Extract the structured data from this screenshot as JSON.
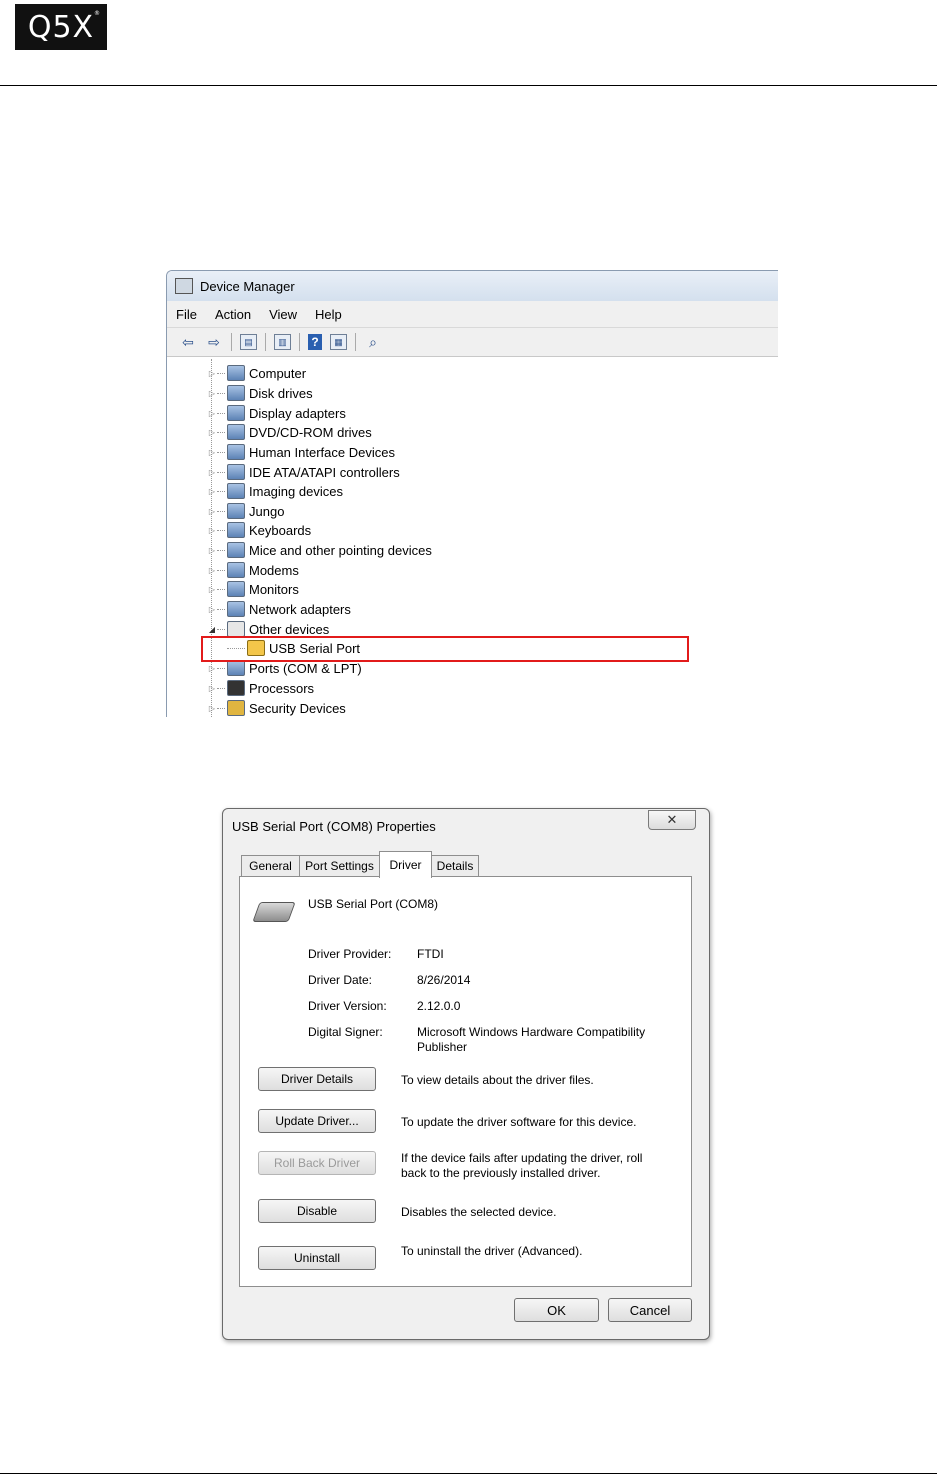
{
  "logo": {
    "text": "Q5X",
    "reg": "®"
  },
  "device_manager": {
    "title": "Device Manager",
    "menu": [
      "File",
      "Action",
      "View",
      "Help"
    ],
    "toolbar": {
      "help": "?"
    },
    "tree": [
      {
        "label": "Computer",
        "icon": "computer-icon"
      },
      {
        "label": "Disk drives",
        "icon": "disk-drive-icon"
      },
      {
        "label": "Display adapters",
        "icon": "display-adapter-icon"
      },
      {
        "label": "DVD/CD-ROM drives",
        "icon": "dvd-icon"
      },
      {
        "label": "Human Interface Devices",
        "icon": "hid-icon"
      },
      {
        "label": "IDE ATA/ATAPI controllers",
        "icon": "ide-icon"
      },
      {
        "label": "Imaging devices",
        "icon": "camera-icon"
      },
      {
        "label": "Jungo",
        "icon": "jungo-icon"
      },
      {
        "label": "Keyboards",
        "icon": "keyboard-icon"
      },
      {
        "label": "Mice and other pointing devices",
        "icon": "mouse-icon"
      },
      {
        "label": "Modems",
        "icon": "modem-icon"
      },
      {
        "label": "Monitors",
        "icon": "monitor-icon"
      },
      {
        "label": "Network adapters",
        "icon": "network-icon"
      },
      {
        "label": "Other devices",
        "icon": "unknown-device-icon",
        "expanded": true
      },
      {
        "label": "USB Serial Port",
        "icon": "warning-device-icon",
        "child": true
      },
      {
        "label": "Ports (COM & LPT)",
        "icon": "port-icon"
      },
      {
        "label": "Processors",
        "icon": "processor-icon"
      },
      {
        "label": "Security Devices",
        "icon": "key-icon"
      }
    ]
  },
  "properties": {
    "title": "USB Serial Port (COM8) Properties",
    "close": "✕",
    "tabs": [
      "General",
      "Port Settings",
      "Driver",
      "Details"
    ],
    "active_tab": "Driver",
    "device_name": "USB Serial Port (COM8)",
    "driver_provider_label": "Driver Provider:",
    "driver_provider": "FTDI",
    "driver_date_label": "Driver Date:",
    "driver_date": "8/26/2014",
    "driver_version_label": "Driver Version:",
    "driver_version": "2.12.0.0",
    "digital_signer_label": "Digital Signer:",
    "digital_signer": "Microsoft Windows Hardware Compatibility Publisher",
    "buttons": {
      "driver_details": "Driver Details",
      "update_driver": "Update Driver...",
      "roll_back": "Roll Back Driver",
      "disable": "Disable",
      "uninstall": "Uninstall",
      "ok": "OK",
      "cancel": "Cancel"
    },
    "descriptions": {
      "driver_details": "To view details about the driver files.",
      "update_driver": "To update the driver software for this device.",
      "roll_back": "If the device fails after updating the driver, roll back to the previously installed driver.",
      "disable": "Disables the selected device.",
      "uninstall": "To uninstall the driver (Advanced)."
    }
  }
}
